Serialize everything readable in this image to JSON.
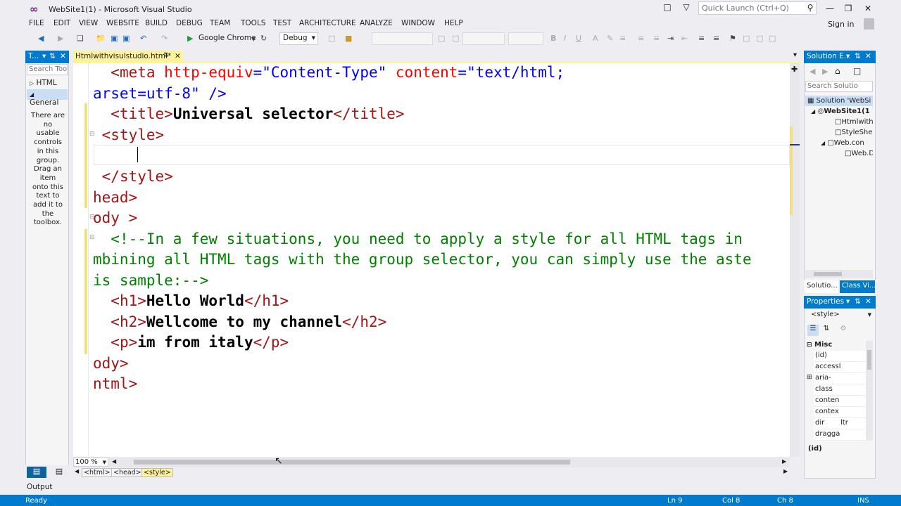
{
  "window": {
    "title": "WebSite1(1) - Microsoft Visual Studio",
    "quick_launch_placeholder": "Quick Launch (Ctrl+Q)",
    "sign_in": "Sign in"
  },
  "menu": [
    "FILE",
    "EDIT",
    "VIEW",
    "WEBSITE",
    "BUILD",
    "DEBUG",
    "TEAM",
    "TOOLS",
    "TEST",
    "ARCHITECTURE",
    "ANALYZE",
    "WINDOW",
    "HELP"
  ],
  "toolbar": {
    "browser": "Google Chrome",
    "config": "Debug"
  },
  "toolbox": {
    "title": "T...",
    "search": "Search Tool",
    "groups": [
      "HTML",
      "General"
    ],
    "empty_text": "There are no usable controls in this group. Drag an item onto this text to add it to the toolbox."
  },
  "editor": {
    "tab": "Htmlwithvisulstudio.html*",
    "lines": [
      [
        "<meta http-equiv=\"Content-Type\" content=\"text/html;",
        "arset=utf-8\" />",
        "<title>Universal selector</title>",
        "<style>",
        "",
        "</style>",
        "head>",
        "ody >"
      ],
      [
        "<!--In a few situations, you need to apply a style for all HTML tags in",
        "mbining all HTML tags with the group selector, you can simply use the aste",
        "is sample:-->"
      ],
      [
        "<h1>Hello World</h1>",
        "<h2>Wellcome to my channel</h2>",
        "<p>im from italy</p>",
        "body>",
        "ntml>"
      ]
    ],
    "code": {
      "l1a": "<meta ",
      "l1b": "http-equiv",
      "l1c": "=",
      "l1d": "\"Content-Type\"",
      "l1e": " content",
      "l1f": "=",
      "l1g": "\"text/html;",
      "l2a": "arset=utf-8\"",
      "l2b": " />",
      "l3a": "<title>",
      "l3b": "Universal selector",
      "l3c": "</title>",
      "l4": "<style>",
      "l6": "</style>",
      "l7": "head>",
      "l8": "ody >",
      "l9": "<!--In a few situations, you need to apply a style for all HTML tags in",
      "l10": "mbining all HTML tags with the group selector, you can simply use the aste",
      "l11": "is sample:-->",
      "l12a": "<h1>",
      "l12b": "Hello World",
      "l12c": "</h1>",
      "l13a": "<h2>",
      "l13b": "Wellcome to my channel",
      "l13c": "</h2>",
      "l14a": "<p>",
      "l14b": "im from italy",
      "l14c": "</p>",
      "l15": "ody>",
      "l16": "ntml>"
    },
    "zoom": "100 %",
    "breadcrumbs": [
      "<html>",
      "<head>",
      "<style>"
    ]
  },
  "solution_explorer": {
    "title": "Solution E...",
    "search": "Search Solutio",
    "items": [
      "Solution 'WebSi",
      "WebSite1(1",
      "Htmlwith",
      "StyleShee",
      "Web.con",
      "Web.D"
    ],
    "tabs": [
      "Solutio...",
      "Class Vi..."
    ]
  },
  "properties": {
    "title": "Properties",
    "object": "<style>",
    "category": "Misc",
    "rows": [
      [
        "(id)",
        ""
      ],
      [
        "accessl",
        ""
      ],
      [
        "aria-",
        ""
      ],
      [
        "class",
        ""
      ],
      [
        "conten",
        ""
      ],
      [
        "contex",
        ""
      ],
      [
        "dir",
        "ltr"
      ],
      [
        "dragga",
        ""
      ]
    ],
    "description": "(id)"
  },
  "output": {
    "label": "Output"
  },
  "status": {
    "ready": "Ready",
    "ln": "Ln 9",
    "col": "Col 8",
    "ch": "Ch 8",
    "ins": "INS"
  },
  "colors": {
    "accent": "#007ACC",
    "vs_purple": "#68217A",
    "tab_yellow": "#FFF29D",
    "tag": "#A31515",
    "attr": "#FF0000",
    "value": "#0000FF",
    "comment": "#008000"
  }
}
